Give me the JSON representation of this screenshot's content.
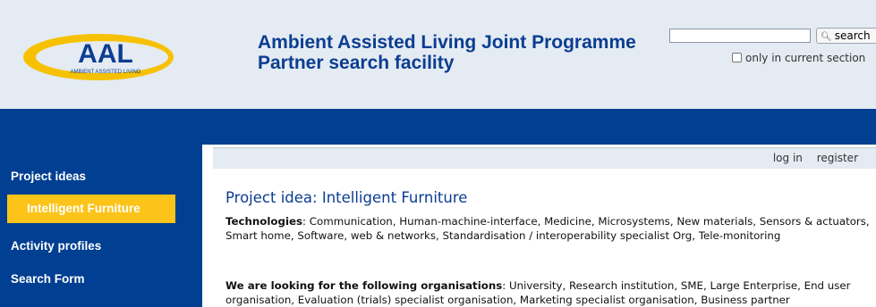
{
  "logo": {
    "text": "AAL",
    "subtext": "AMBIENT ASSISTED LIVING"
  },
  "header": {
    "title_line1": "Ambient Assisted Living Joint Programme",
    "title_line2": "Partner search facility"
  },
  "search": {
    "value": "",
    "button_label": "search",
    "only_current_label": "only in current section",
    "only_current_checked": false
  },
  "sidebar": {
    "items": [
      {
        "label": "Project ideas",
        "active": false
      },
      {
        "label": "Intelligent Furniture",
        "active": true
      },
      {
        "label": "Activity profiles",
        "active": false
      },
      {
        "label": "Search Form",
        "active": false
      }
    ]
  },
  "topnav": {
    "login": "log in",
    "register": "register"
  },
  "main": {
    "title": "Project idea: Intelligent Furniture",
    "technologies_label": "Technologies",
    "technologies_value": "Communication, Human-machine-interface, Medicine, Microsystems, New materials, Sensors & actuators, Smart home, Software, web & networks, Standardisation / interoperability specialist Org, Tele-monitoring",
    "looking_label": "We are looking for the following organisations",
    "looking_value": "University, Research institution, SME, Large Enterprise, End user organisation, Evaluation (trials) specialist organisation, Marketing specialist organisation, Business partner"
  },
  "colors": {
    "header_bg": "#e4ebf2",
    "brand_blue": "#003f91",
    "accent_yellow": "#fcc319",
    "title_blue": "#0b3d91"
  }
}
